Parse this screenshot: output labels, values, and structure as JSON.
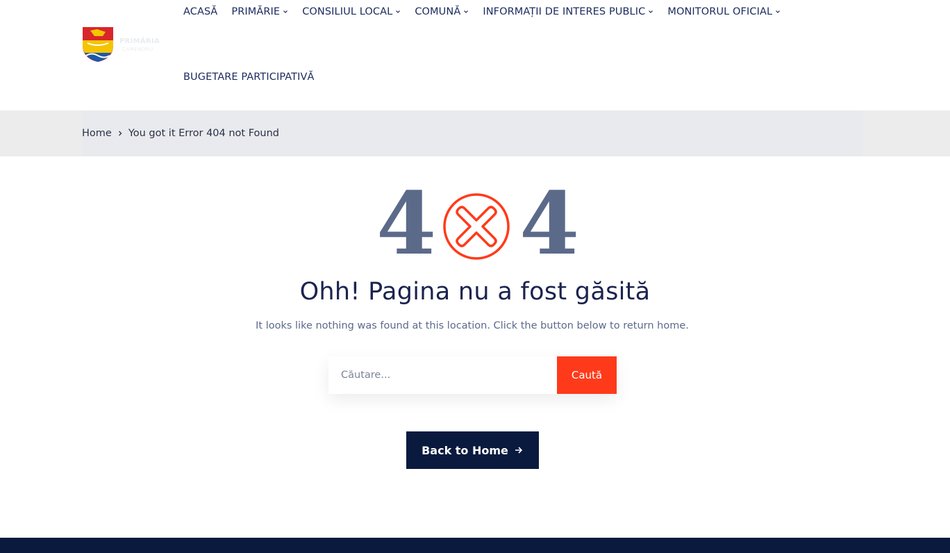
{
  "header": {
    "logo": {
      "text": "PRIMĂRIA",
      "sub": "CAMENDRU"
    },
    "nav": [
      {
        "label": "ACASĂ",
        "has_dropdown": false
      },
      {
        "label": "PRIMĂRIE",
        "has_dropdown": true
      },
      {
        "label": "CONSILIUL LOCAL",
        "has_dropdown": true
      },
      {
        "label": "COMUNĂ",
        "has_dropdown": true
      },
      {
        "label": "INFORMAȚII DE INTERES PUBLIC",
        "has_dropdown": true
      },
      {
        "label": "MONITORUL OFICIAL",
        "has_dropdown": true
      },
      {
        "label": "BUGETARE PARTICIPATIVĂ",
        "has_dropdown": false
      }
    ]
  },
  "breadcrumb": {
    "home": "Home",
    "current": "You got it Error 404 not Found"
  },
  "error": {
    "digit_left": "4",
    "digit_right": "4",
    "title": "Ohh! Pagina nu a fost găsită",
    "text": "It looks like nothing was found at this location. Click the button below to return home."
  },
  "search": {
    "placeholder": "Căutare...",
    "button": "Caută"
  },
  "back_home": {
    "label": "Back to Home"
  },
  "colors": {
    "accent": "#ff3a1a",
    "navy": "#0a1a3f",
    "digit": "#5c6a8a",
    "breadcrumb_bg": "#e8eaed"
  },
  "icons": {
    "error": "x-circle-icon",
    "dropdown": "chevron-down-icon",
    "breadcrumb_sep": "chevron-right-icon",
    "back": "arrow-right-icon"
  }
}
